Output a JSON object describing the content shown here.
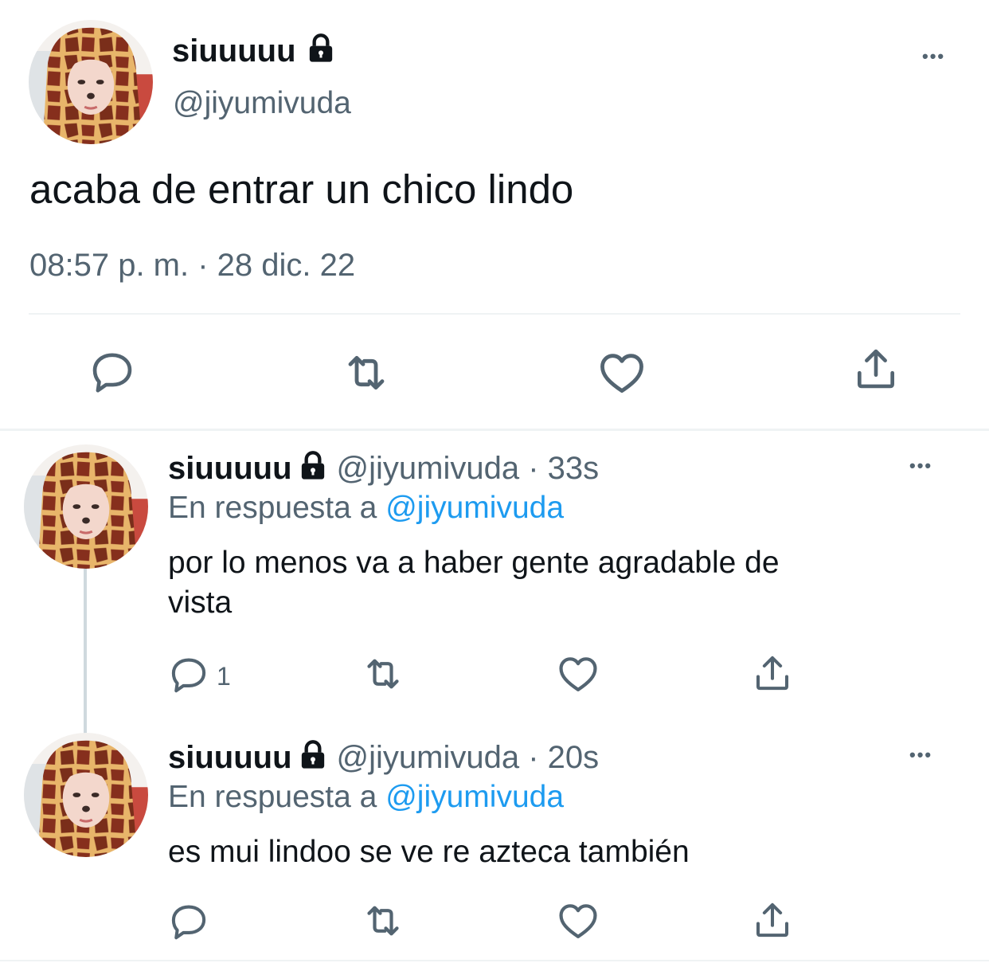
{
  "main_tweet": {
    "display_name": "siuuuuu",
    "handle": "@jiyumivuda",
    "text": "acaba de entrar un chico lindo",
    "timestamp": "08:57 p. m. · 28 dic. 22",
    "more_label": "•••"
  },
  "replies": [
    {
      "display_name": "siuuuuu",
      "handle": "@jiyumivuda",
      "time": "· 33s",
      "reply_prefix": "En respuesta a",
      "reply_to": "@jiyumivuda",
      "text_line1": "por lo menos va a haber gente agradable de",
      "text_line2": "vista",
      "reply_count": "1",
      "more_label": "•••"
    },
    {
      "display_name": "siuuuuu",
      "handle": "@jiyumivuda",
      "time": "· 20s",
      "reply_prefix": "En respuesta a",
      "reply_to": "@jiyumivuda",
      "text_line1": "es mui lindoo se ve re azteca también",
      "reply_count": "",
      "more_label": "•••"
    }
  ],
  "icons": {
    "reply": "speech-bubble-icon",
    "retweet": "retweet-icon",
    "like": "heart-icon",
    "share": "share-icon",
    "lock": "lock-icon"
  },
  "colors": {
    "text": "#0f1419",
    "muted": "#536471",
    "link": "#1d9bf0",
    "divider": "#eff3f4"
  }
}
